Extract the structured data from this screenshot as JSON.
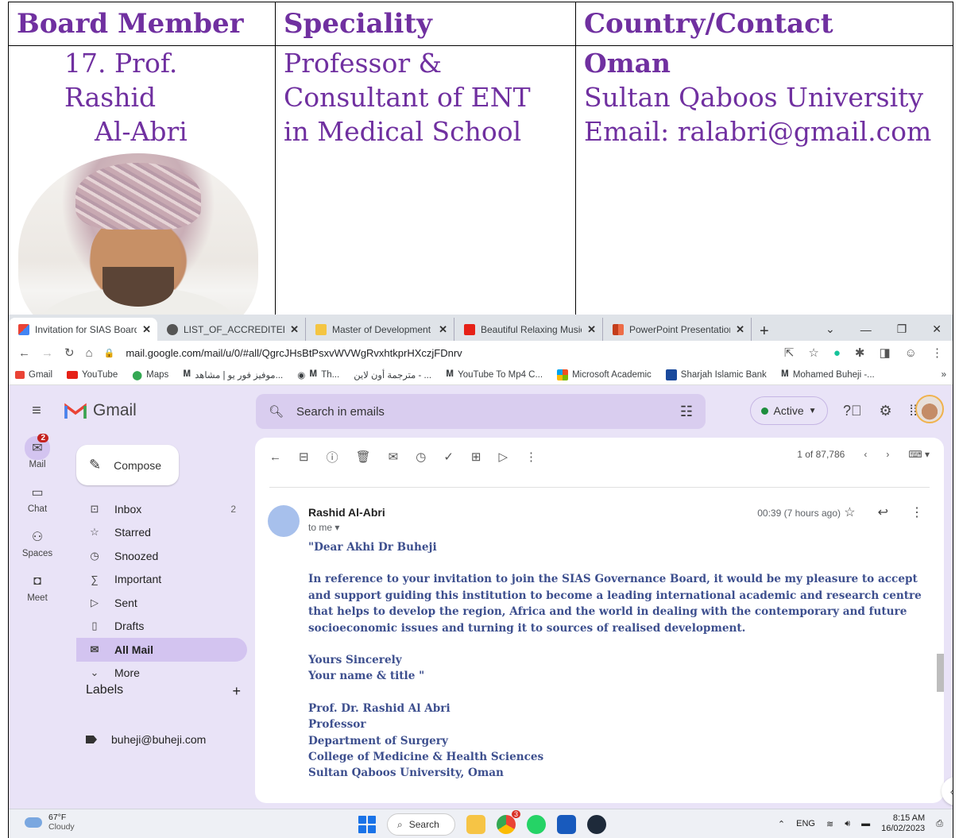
{
  "doc": {
    "headers": [
      "Board Member",
      "Speciality",
      "Country/Contact"
    ],
    "member_line1": "17. Prof. Rashid",
    "member_line2": "Al-Abri",
    "speciality": [
      "Professor &",
      "Consultant of ENT",
      "in Medical School"
    ],
    "country": "Oman",
    "contact": [
      "Sultan Qaboos University",
      "Email: ralabri@gmail.com"
    ]
  },
  "browser": {
    "tabs": [
      {
        "label": "Invitation for SIAS Board",
        "icon": "gmail-icon"
      },
      {
        "label": "LIST_OF_ACCREDITED_AC",
        "icon": "globe-icon"
      },
      {
        "label": "Master of Development S",
        "icon": "certificate-icon"
      },
      {
        "label": "Beautiful Relaxing Music",
        "icon": "youtube-icon"
      },
      {
        "label": "PowerPoint Presentation",
        "icon": "powerpoint-icon"
      }
    ],
    "url": "mail.google.com/mail/u/0/#all/QgrcJHsBtPsxvWVWgRvxhtkprHXczjFDnrv",
    "bookmarks": [
      "Gmail",
      "YouTube",
      "Maps",
      "موفيز فور يو | مشاهد...",
      "Th...",
      "مترجمة أون لاين - ...",
      "YouTube To Mp4 C...",
      "Microsoft Academic",
      "Sharjah Islamic Bank",
      "Mohamed Buheji -..."
    ]
  },
  "gmail": {
    "logo": "Gmail",
    "search_placeholder": "Search in emails",
    "status": "Active",
    "rail": [
      {
        "label": "Mail",
        "badge": "2"
      },
      {
        "label": "Chat"
      },
      {
        "label": "Spaces"
      },
      {
        "label": "Meet"
      }
    ],
    "compose": "Compose",
    "nav": [
      {
        "label": "Inbox",
        "count": "2"
      },
      {
        "label": "Starred"
      },
      {
        "label": "Snoozed"
      },
      {
        "label": "Important"
      },
      {
        "label": "Sent"
      },
      {
        "label": "Drafts"
      },
      {
        "label": "All Mail"
      },
      {
        "label": "More"
      }
    ],
    "labels_title": "Labels",
    "label_item": "buheji@buheji.com",
    "pager": "1 of 87,786",
    "message": {
      "sender": "Rashid Al-Abri",
      "to": "to me",
      "time": "00:39 (7 hours ago)",
      "greeting": "\"Dear Akhi Dr Buheji",
      "paragraph": "In reference to your invitation to join the SIAS Governance Board, it would be my pleasure to accept and support guiding this institution to become a leading international academic and research centre that helps to develop the region, Africa and the world in dealing with the contemporary and future socioeconomic issues and turning it to sources of realised development.",
      "closing1": "Yours Sincerely",
      "closing2": "Your name & title \"",
      "sig": [
        "Prof. Dr. Rashid Al Abri",
        "Professor",
        "Department of Surgery",
        "College of Medicine & Health Sciences",
        "Sultan Qaboos University, Oman"
      ]
    }
  },
  "taskbar": {
    "temp": "67°F",
    "weather": "Cloudy",
    "search": "Search",
    "chrome_badge": "3",
    "lang": "ENG",
    "time": "8:15 AM",
    "date": "16/02/2023"
  },
  "colors": {
    "doc_text": "#7030a0",
    "gmail_bg": "#e9e3f7",
    "email_text": "#3d4f8e"
  }
}
